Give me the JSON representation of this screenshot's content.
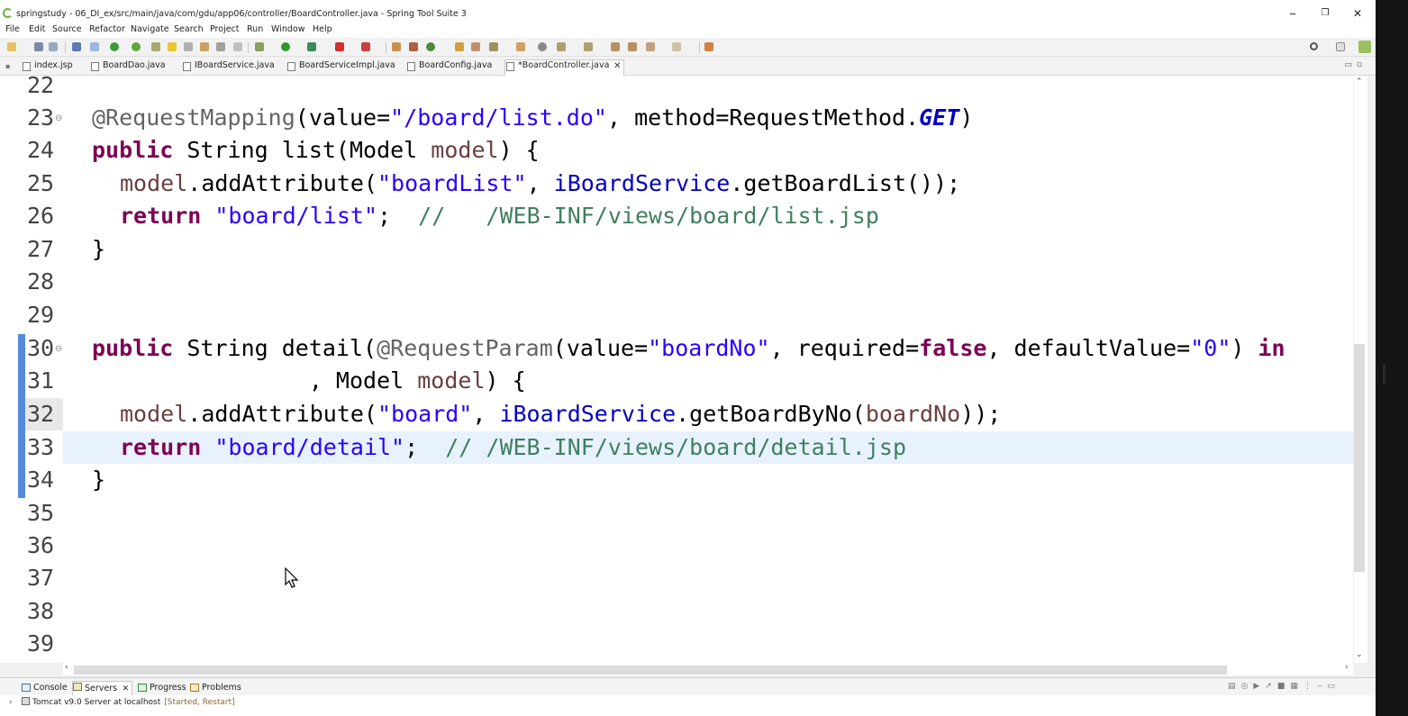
{
  "window": {
    "title": "springstudy - 06_DI_ex/src/main/java/com/gdu/app06/controller/BoardController.java - Spring Tool Suite 3",
    "minimize": "‒",
    "restore": "❐",
    "close": "✕"
  },
  "menu": [
    "File",
    "Edit",
    "Source",
    "Refactor",
    "Navigate",
    "Search",
    "Project",
    "Run",
    "Window",
    "Help"
  ],
  "tabs": [
    {
      "label": "index.jsp"
    },
    {
      "label": "BoardDao.java"
    },
    {
      "label": "IBoardService.java"
    },
    {
      "label": "BoardServiceImpl.java"
    },
    {
      "label": "BoardConfig.java"
    },
    {
      "label": "*BoardController.java",
      "close": "✕"
    }
  ],
  "editor": {
    "lines": [
      {
        "no": "22"
      },
      {
        "no": "23"
      },
      {
        "no": "24"
      },
      {
        "no": "25"
      },
      {
        "no": "26"
      },
      {
        "no": "27"
      },
      {
        "no": "28"
      },
      {
        "no": "29"
      },
      {
        "no": "30"
      },
      {
        "no": "31"
      },
      {
        "no": "32"
      },
      {
        "no": "33"
      },
      {
        "no": "34"
      },
      {
        "no": "35"
      },
      {
        "no": "36"
      },
      {
        "no": "37"
      },
      {
        "no": "38"
      },
      {
        "no": "39"
      }
    ],
    "code": {
      "l23": {
        "a": "@RequestMapping",
        "b": "(value=",
        "c": "\"/board/list.do\"",
        "d": ", method=RequestMethod.",
        "e": "GET",
        "f": ")"
      },
      "l24": {
        "a": "public",
        "b": " String list(Model ",
        "c": "model",
        "d": ") {"
      },
      "l25": {
        "a": "model",
        "b": ".addAttribute(",
        "c": "\"boardList\"",
        "d": ", ",
        "e": "iBoardService",
        "f": ".getBoardList());"
      },
      "l26": {
        "a": "return",
        "b": " ",
        "c": "\"board/list\"",
        "d": ";  ",
        "e": "//   /WEB-INF/views/board/list.jsp"
      },
      "l27": {
        "a": "}"
      },
      "l30": {
        "a": "public",
        "b": " String detail(",
        "c": "@RequestParam",
        "d": "(value=",
        "e": "\"boardNo\"",
        "f": ", required=",
        "g": "false",
        "h": ", defaultValue=",
        "i": "\"0\"",
        "j": ") ",
        "k": "in"
      },
      "l31": {
        "a": "                , Model ",
        "b": "model",
        "c": ") {"
      },
      "l32": {
        "a": "model",
        "b": ".addAttribute(",
        "c": "\"board\"",
        "d": ", ",
        "e": "iBoardService",
        "f": ".getBoardByNo(",
        "g": "boardNo",
        "h": "));"
      },
      "l33": {
        "a": "return",
        "b": " ",
        "c": "\"board/detail\"",
        "d": ";  ",
        "e": "// /WEB-INF/views/board/detail.jsp"
      },
      "l34": {
        "a": "}"
      }
    }
  },
  "bottom": {
    "tabs": [
      {
        "label": "Console"
      },
      {
        "label": "Servers",
        "close": "✕"
      },
      {
        "label": "Progress"
      },
      {
        "label": "Problems"
      }
    ],
    "server": {
      "name": "Tomcat v9.0 Server at localhost",
      "state": "[Started, Restart]"
    }
  },
  "colors": {
    "keyword": "#7f0055",
    "string": "#2a00ff",
    "comment": "#3f7f5f",
    "field": "#0000c0",
    "annotation": "#646464",
    "current_line": "#e8f2fe"
  }
}
